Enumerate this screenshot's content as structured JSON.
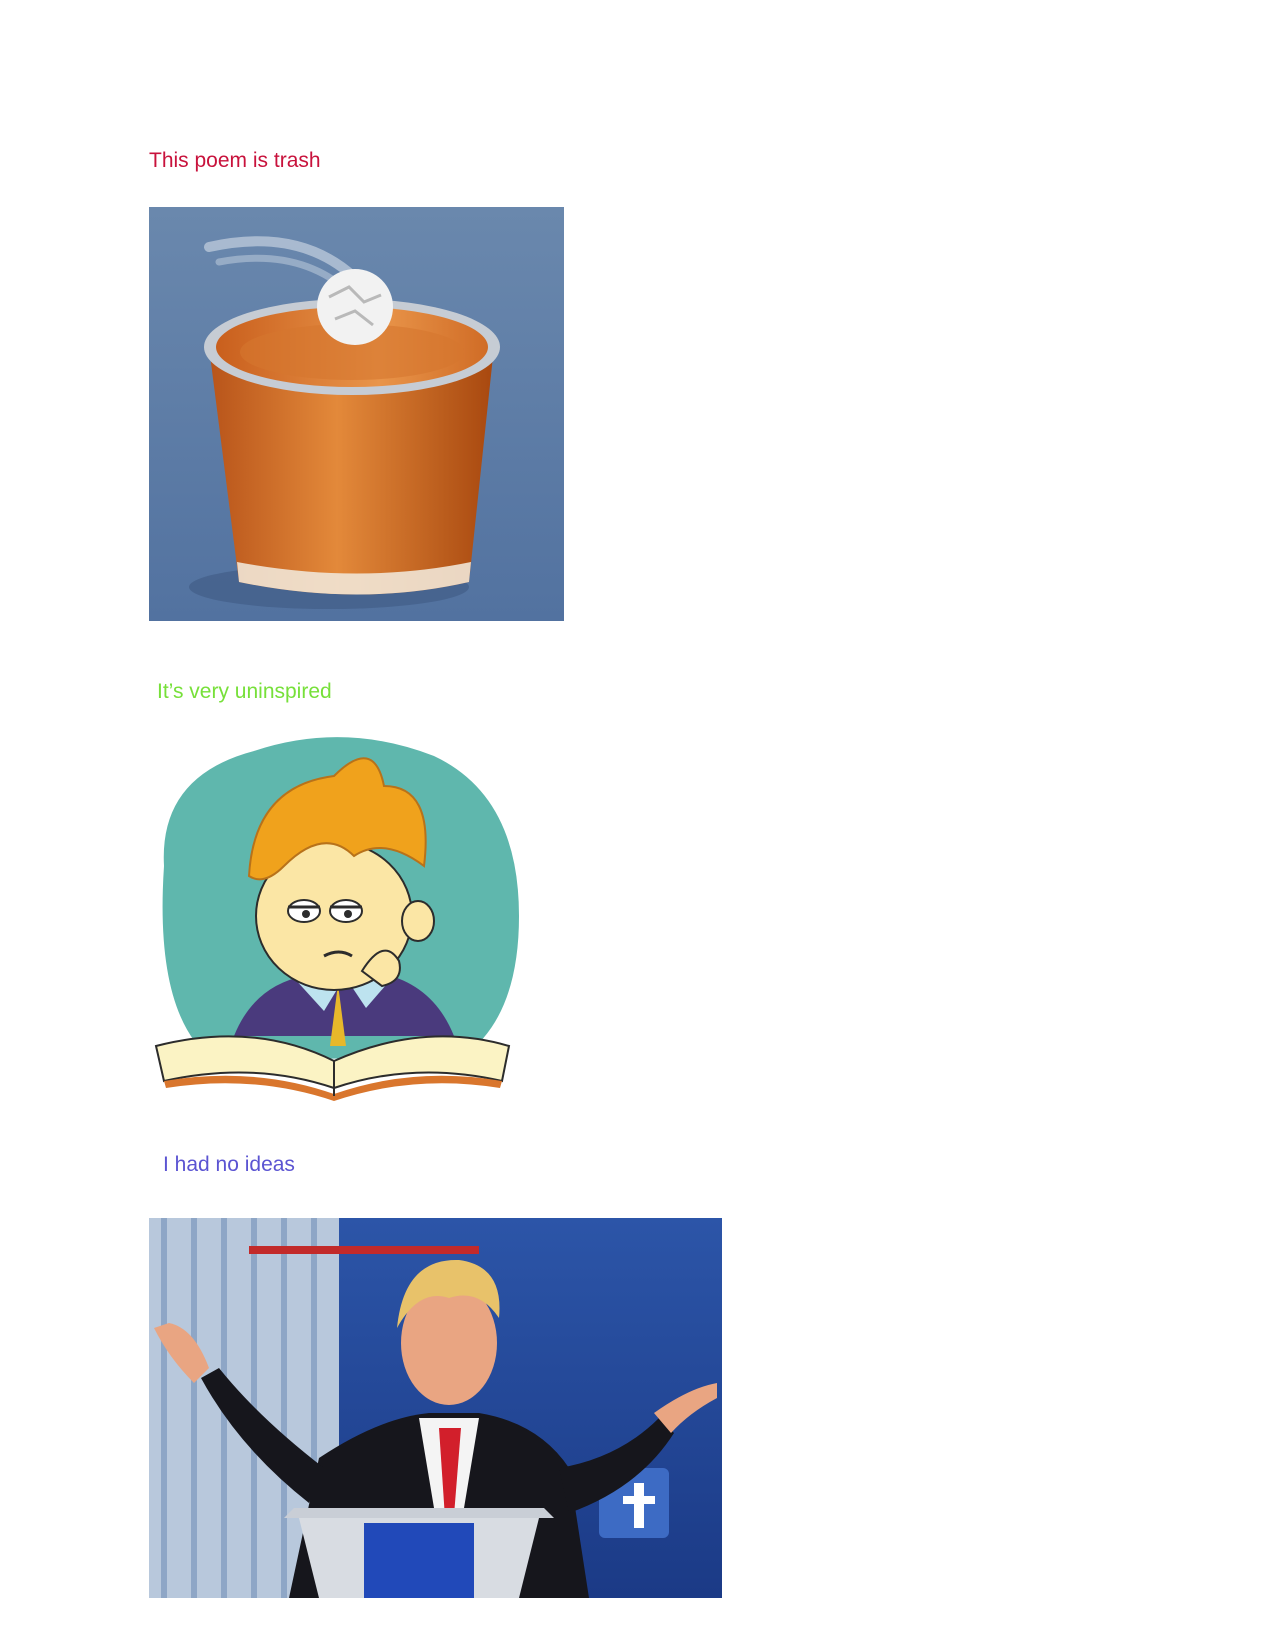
{
  "captions": [
    {
      "text": "This poem is trash",
      "color": "#c8123c"
    },
    {
      "text": "It’s very uninspired",
      "color": "#77e03a"
    },
    {
      "text": "I had no ideas",
      "color": "#5b54d2"
    }
  ],
  "images": [
    {
      "name": "trash-bin-illustration"
    },
    {
      "name": "bored-reader-cartoon"
    },
    {
      "name": "shrugging-man-at-podium-photo"
    }
  ]
}
